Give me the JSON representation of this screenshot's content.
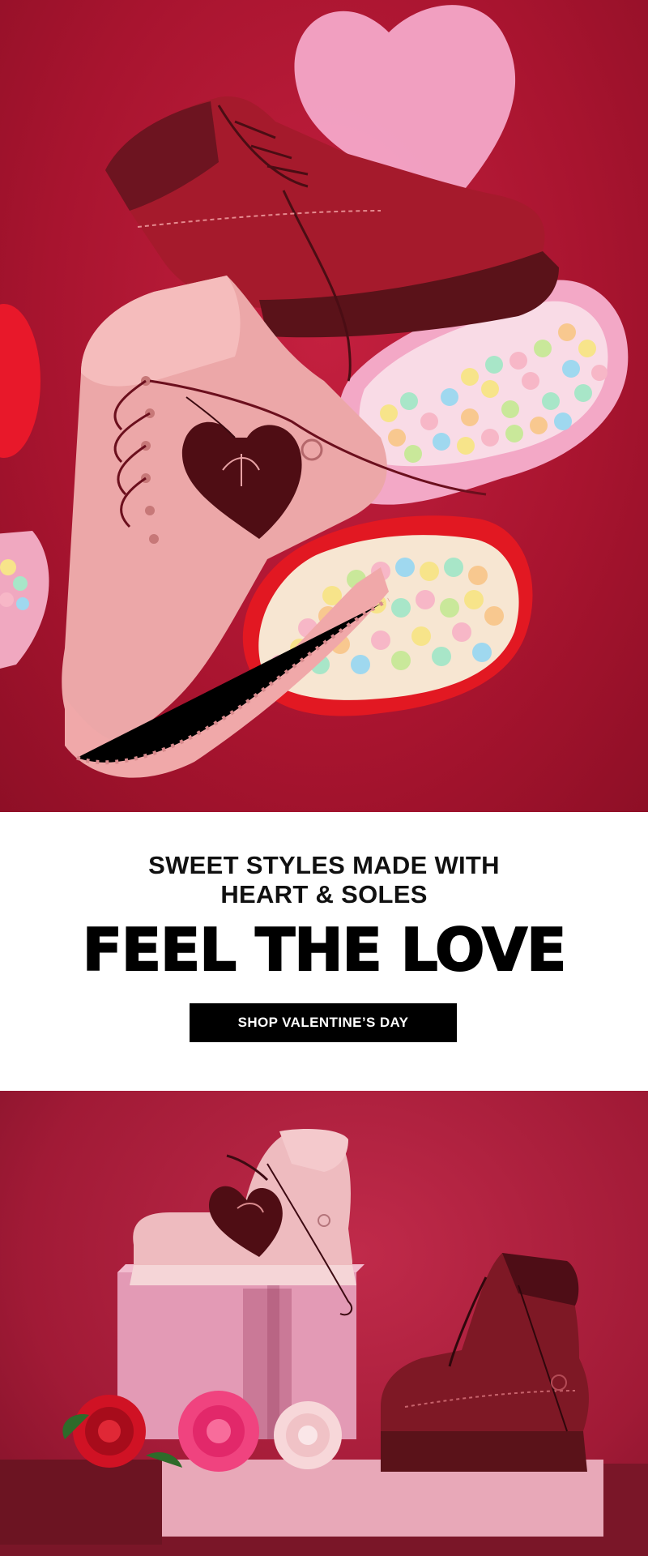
{
  "hero_top": {
    "alt": "Pink and burgundy boots with heart-shaped candy boxes"
  },
  "promo": {
    "subheading_line1": "SWEET STYLES MADE WITH",
    "subheading_line2": "HEART & SOLES",
    "heading": "FEEL THE LOVE",
    "cta_label": "SHOP VALENTINE’S DAY"
  },
  "hero_bottom": {
    "alt": "Boots on pink cinder blocks with roses"
  },
  "colors": {
    "background_red": "#a8142f",
    "cta_bg": "#000000",
    "cta_text": "#ffffff",
    "boot_pink": "#e9a3a6",
    "boot_burgundy": "#8a1a26"
  }
}
